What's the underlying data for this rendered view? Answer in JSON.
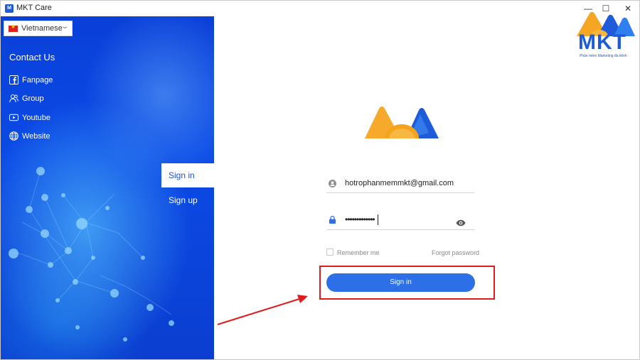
{
  "window": {
    "title": "MKT Care",
    "app_icon_text": "M",
    "controls": {
      "minimize": "—",
      "maximize": "☐",
      "close": "✕"
    }
  },
  "language": {
    "selected": "Vietnamese",
    "flag_color": "#d8231f"
  },
  "contact": {
    "title": "Contact Us",
    "items": [
      {
        "label": "Fanpage",
        "icon": "facebook-icon"
      },
      {
        "label": "Group",
        "icon": "group-icon"
      },
      {
        "label": "Youtube",
        "icon": "youtube-icon"
      },
      {
        "label": "Website",
        "icon": "globe-icon"
      }
    ]
  },
  "tabs": {
    "signin": "Sign in",
    "signup": "Sign up"
  },
  "brand": {
    "name": "MKT",
    "tagline": "Phần mềm Marketing đa kênh",
    "primary": "#1e5bd8",
    "accent": "#f5a623"
  },
  "form": {
    "email": "hotrophanmemmkt@gmail.com",
    "password_mask": "•••••••••••••",
    "remember_label": "Remember me",
    "forgot_label": "Forgot password",
    "submit_label": "Sign in"
  },
  "colors": {
    "panel": "#0b46e0",
    "button": "#2d6fe6",
    "highlight": "#e11b1b"
  }
}
